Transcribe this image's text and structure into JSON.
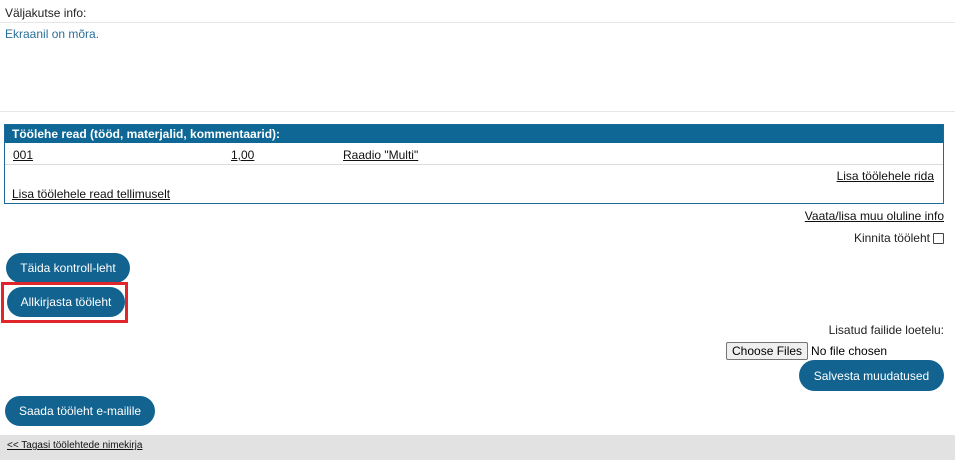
{
  "info": {
    "label": "Väljakutse info:",
    "text": "Ekraanil on mõra."
  },
  "rows_panel": {
    "title": "Töölehe read (tööd, materjalid, kommentaarid):",
    "rows": [
      {
        "id": "001",
        "qty": "1,00",
        "name": "Raadio \"Multi\""
      }
    ],
    "add_row_link": "Lisa töölehele rida",
    "add_from_order_link": "Lisa töölehele read tellimuselt"
  },
  "more_info_link": "Vaata/lisa muu oluline info",
  "confirm_label": "Kinnita tööleht",
  "buttons": {
    "fill_control": "Täida kontroll-leht",
    "sign": "Allkirjasta tööleht",
    "save": "Salvesta muudatused",
    "send_email": "Saada tööleht e-mailile"
  },
  "files": {
    "label": "Lisatud failide loetelu:",
    "choose_button": "Choose Files",
    "status": "No file chosen"
  },
  "footer": {
    "back_link": "<< Tagasi töölehtede nimekirja"
  },
  "colors": {
    "primary": "#12638f",
    "header": "#0e6794",
    "highlight": "#e0262b",
    "info_text": "#2a6f99"
  }
}
